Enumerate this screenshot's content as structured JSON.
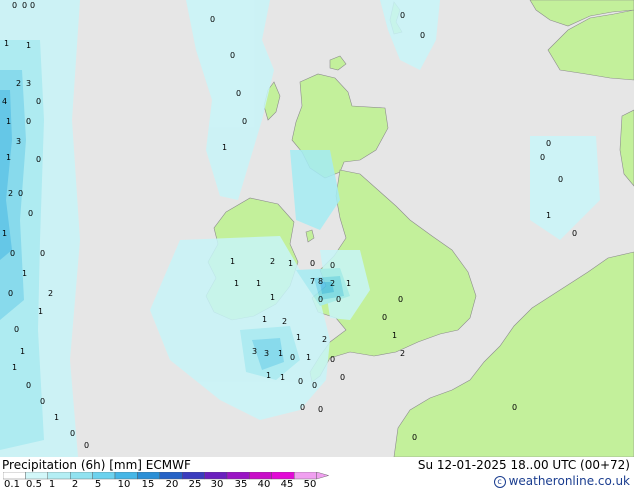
{
  "map": {
    "sea_color": "#e6e6e6",
    "land_color": "#c3f09b",
    "coast_color": "#8c8c8c",
    "precip_colors": [
      "#c8f5f8",
      "#a5ecf4",
      "#78d8ee",
      "#4fc2e8"
    ],
    "ocean_values": [
      "0",
      "0",
      "0",
      "1",
      "1",
      "2",
      "3",
      "4",
      "0",
      "1",
      "0",
      "3",
      "1",
      "0",
      "2",
      "0",
      "0",
      "1",
      "0",
      "0",
      "1",
      "0",
      "2",
      "1",
      "0",
      "1",
      "1",
      "0",
      "0",
      "1",
      "0",
      "0",
      "0",
      "0",
      "0",
      "0",
      "1",
      "0",
      "0",
      "0",
      "0",
      "1",
      "0",
      "0"
    ],
    "land_values": [
      "1",
      "2",
      "1",
      "0",
      "0",
      "1",
      "1",
      "7",
      "8",
      "2",
      "1",
      "1",
      "0",
      "0",
      "1",
      "2",
      "1",
      "2",
      "3",
      "3",
      "1",
      "0",
      "1",
      "1",
      "1",
      "0",
      "0",
      "0",
      "0",
      "1",
      "2",
      "0",
      "0",
      "0",
      "0",
      "0",
      "0"
    ]
  },
  "legend": {
    "title": "Precipitation (6h) [mm] ECMWF",
    "ticks": [
      "0.1",
      "0.5",
      "1",
      "2",
      "5",
      "10",
      "15",
      "20",
      "25",
      "30",
      "35",
      "40",
      "45",
      "50"
    ],
    "colors": [
      "#ffffff",
      "#d2f7f9",
      "#b4eef4",
      "#91e2f0",
      "#6dd2ee",
      "#46b6e6",
      "#2b8fd6",
      "#2562c6",
      "#3a3cbe",
      "#6a1fbe",
      "#9a14c4",
      "#c80ec8",
      "#e20ad6",
      "#f0a0f0"
    ]
  },
  "valid_time": "Su 12-01-2025 18..00 UTC (00+72)",
  "credit": "© weatheronline.co.uk"
}
